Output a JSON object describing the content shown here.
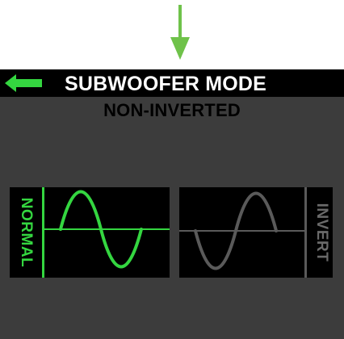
{
  "header": {
    "title": "SUBWOOFER MODE",
    "back_icon": "back-arrow-icon"
  },
  "status": {
    "current_mode": "NON-INVERTED"
  },
  "options": [
    {
      "label": "NORMAL",
      "selected": true,
      "color": "#34d640",
      "icon": "sine-wave-icon"
    },
    {
      "label": "INVERT",
      "selected": false,
      "color": "#5a5a5a",
      "icon": "inverted-sine-wave-icon"
    }
  ],
  "colors": {
    "annotation_arrow": "#6fc24a",
    "screen_background": "#3c3c3c",
    "titlebar": "#000000",
    "accent": "#34d640",
    "inactive": "#5a5a5a",
    "inactive_text": "#6a6a6a"
  }
}
